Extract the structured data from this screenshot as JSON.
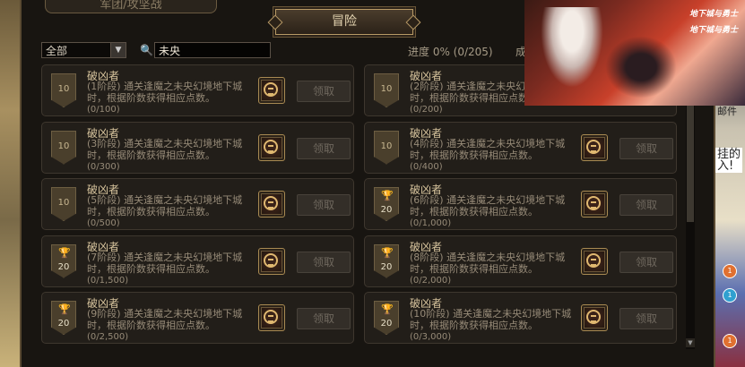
{
  "tabs": {
    "secondary": "军团/攻坚战",
    "active": "冒险"
  },
  "filter": {
    "selected": "全部"
  },
  "search": {
    "value": "未央"
  },
  "progress": {
    "text": "进度  0%  (0/205)",
    "extra": "成"
  },
  "banner": {
    "logo1": "地下城与勇士",
    "logo2": "地下城与勇士"
  },
  "side": {
    "mail": "邮件",
    "label": "挂的\n入!",
    "badge1": "1",
    "badge2": "1",
    "badge3": "1"
  },
  "claim_label": "领取",
  "achievements": [
    {
      "title": "破凶者",
      "desc": "(1阶段) 通关逢魔之未央幻境地下城时，根据阶数获得相应点数。",
      "progress": "(0/100)",
      "points": "10",
      "trophy": false
    },
    {
      "title": "破凶者",
      "desc": "(2阶段) 通关逢魔之未央幻境地下城时，根据阶数获得相应点数。",
      "progress": "(0/200)",
      "points": "10",
      "trophy": false
    },
    {
      "title": "破凶者",
      "desc": "(3阶段) 通关逢魔之未央幻境地下城时，根据阶数获得相应点数。",
      "progress": "(0/300)",
      "points": "10",
      "trophy": false
    },
    {
      "title": "破凶者",
      "desc": "(4阶段) 通关逢魔之未央幻境地下城时，根据阶数获得相应点数。",
      "progress": "(0/400)",
      "points": "10",
      "trophy": false
    },
    {
      "title": "破凶者",
      "desc": "(5阶段) 通关逢魔之未央幻境地下城时，根据阶数获得相应点数。",
      "progress": "(0/500)",
      "points": "10",
      "trophy": false
    },
    {
      "title": "破凶者",
      "desc": "(6阶段) 通关逢魔之未央幻境地下城时，根据阶数获得相应点数。",
      "progress": "(0/1,000)",
      "points": "20",
      "trophy": true
    },
    {
      "title": "破凶者",
      "desc": "(7阶段) 通关逢魔之未央幻境地下城时，根据阶数获得相应点数。",
      "progress": "(0/1,500)",
      "points": "20",
      "trophy": true
    },
    {
      "title": "破凶者",
      "desc": "(8阶段) 通关逢魔之未央幻境地下城时，根据阶数获得相应点数。",
      "progress": "(0/2,000)",
      "points": "20",
      "trophy": true
    },
    {
      "title": "破凶者",
      "desc": "(9阶段) 通关逢魔之未央幻境地下城时，根据阶数获得相应点数。",
      "progress": "(0/2,500)",
      "points": "20",
      "trophy": true
    },
    {
      "title": "破凶者",
      "desc": "(10阶段) 通关逢魔之未央幻境地下城时，根据阶数获得相应点数。",
      "progress": "(0/3,000)",
      "points": "20",
      "trophy": true
    }
  ]
}
